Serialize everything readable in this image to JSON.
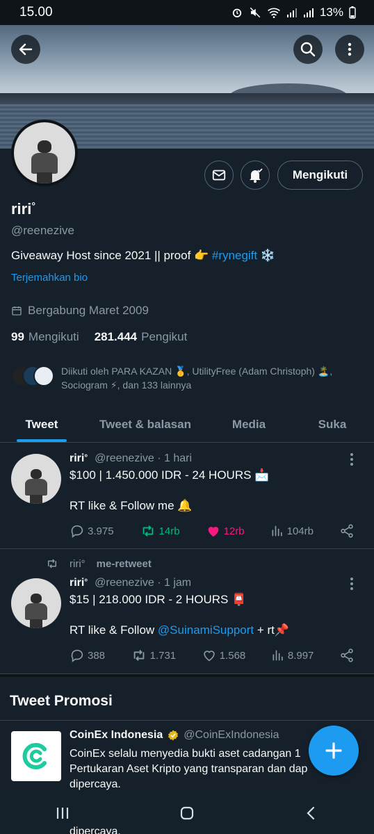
{
  "status_bar": {
    "time": "15.00",
    "battery": "13%"
  },
  "profile": {
    "name": "riri",
    "name_mark": "°",
    "handle": "@reenezive",
    "follow_button": "Mengikuti",
    "bio_prefix": "Giveaway Host since 2021 || proof 👉 ",
    "bio_hashtag": "#rynegift",
    "bio_suffix": " ❄️",
    "translate_bio": "Terjemahkan bio",
    "joined": "Bergabung Maret 2009",
    "following_count": "99",
    "following_label": "Mengikuti",
    "followers_count": "281.444",
    "followers_label": "Pengikut",
    "followed_by": "Diikuti oleh PARA KAZAN 🥇, UtilityFree (Adam Christoph) 🏝️, Sociogram ⚡, dan 133 lainnya"
  },
  "tabs": [
    {
      "label": "Tweet",
      "active": true
    },
    {
      "label": "Tweet & balasan",
      "active": false
    },
    {
      "label": "Media",
      "active": false
    },
    {
      "label": "Suka",
      "active": false
    }
  ],
  "tweets": [
    {
      "name": "riri",
      "name_mark": "°",
      "handle": "@reenezive",
      "time": "· 1 hari",
      "line1": "$100 | 1.450.000 IDR - 24 HOURS 📩",
      "line2": "RT like & Follow me 🔔",
      "replies": "3.975",
      "retweets": "14rb",
      "likes": "12rb",
      "views": "104rb"
    },
    {
      "retweet_by": "riri°",
      "retweet_label": "me-retweet",
      "name": "riri",
      "name_mark": "°",
      "handle": "@reenezive",
      "time": "· 1 jam",
      "line1": "$15 | 218.000 IDR - 2 HOURS 📮",
      "line2_prefix": "RT like & Follow ",
      "line2_mention": "@SuinamiSupport",
      "line2_suffix": " + rt📌",
      "replies": "388",
      "retweets": "1.731",
      "likes": "1.568",
      "views": "8.997"
    }
  ],
  "promo": {
    "section_title": "Tweet Promosi",
    "name": "CoinEx Indonesia",
    "handle": "@CoinExIndonesia",
    "text": "CoinEx selalu menyedia bukti aset cadangan 1 Pertukaran Aset Kripto yang transparan dan dap dipercaya.",
    "peek": "dipercaya."
  },
  "colors": {
    "background": "#15202b",
    "accent": "#1d9bf0",
    "retweet_active": "#00ba7c",
    "like_active": "#f91880",
    "muted": "#8b98a5"
  }
}
